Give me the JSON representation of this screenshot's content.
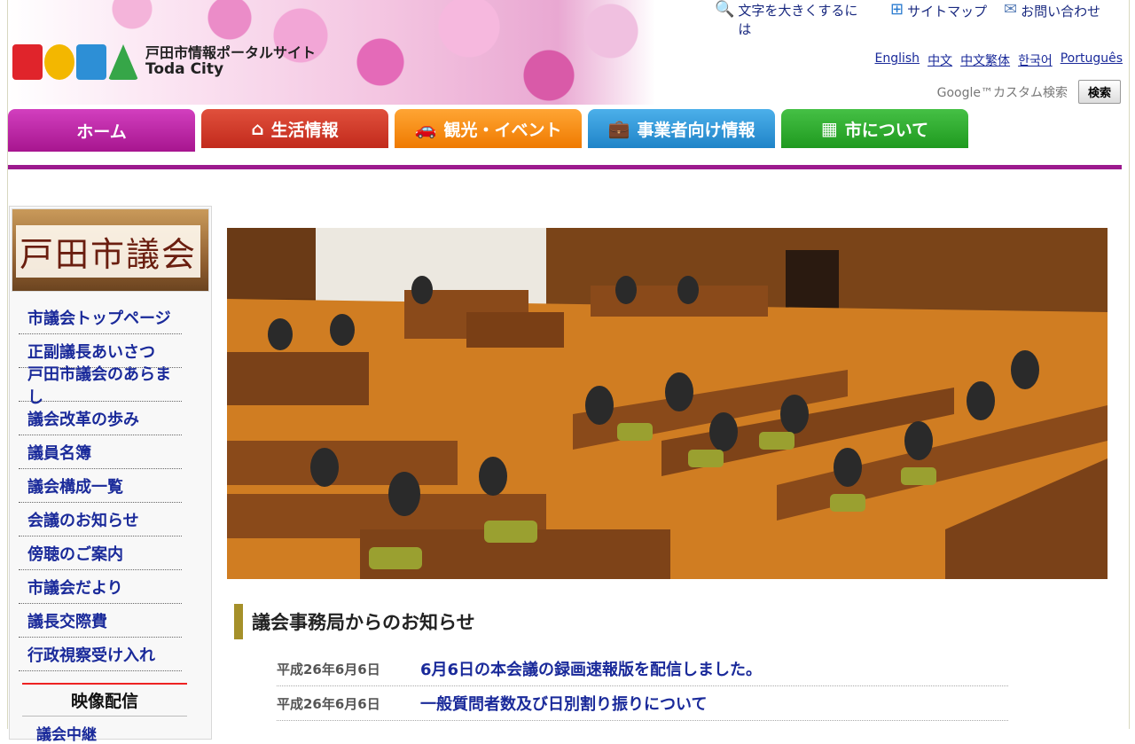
{
  "header": {
    "logo_title_jp": "戸田市情報ポータルサイト",
    "logo_title_en": "Toda City",
    "utils": [
      {
        "label": "文字を大きくするには",
        "icon": "magnifier-icon"
      },
      {
        "label": "サイトマップ",
        "icon": "sitemap-icon"
      },
      {
        "label": "お問い合わせ",
        "icon": "mail-icon"
      }
    ],
    "languages": [
      "English",
      "中文",
      "中文繁体",
      "한국어",
      "Português"
    ],
    "search_label": "Google™カスタム検索",
    "search_button": "検索"
  },
  "nav": {
    "tabs": [
      {
        "label": "ホーム",
        "icon": ""
      },
      {
        "label": "生活情報",
        "icon": "house-icon"
      },
      {
        "label": "観光・イベント",
        "icon": "car-icon"
      },
      {
        "label": "事業者向け情報",
        "icon": "briefcase-icon"
      },
      {
        "label": "市について",
        "icon": "city-icon"
      }
    ]
  },
  "sidebar": {
    "banner_title": "戸田市議会",
    "items": [
      "市議会トップページ",
      "正副議長あいさつ",
      "戸田市議会のあらまし",
      "議会改革の歩み",
      "議員名簿",
      "議会構成一覧",
      "会議のお知らせ",
      "傍聴のご案内",
      "市議会だより",
      "議長交際費",
      "行政視察受け入れ"
    ],
    "video_heading": "映像配信",
    "video_link": "議会中継"
  },
  "main": {
    "notice_title": "議会事務局からのお知らせ",
    "news": [
      {
        "date": "平成26年6月6日",
        "title": "6月6日の本会議の録画速報版を配信しました。"
      },
      {
        "date": "平成26年6月6日",
        "title": "一般質問者数及び日別割り振りについて"
      }
    ]
  }
}
